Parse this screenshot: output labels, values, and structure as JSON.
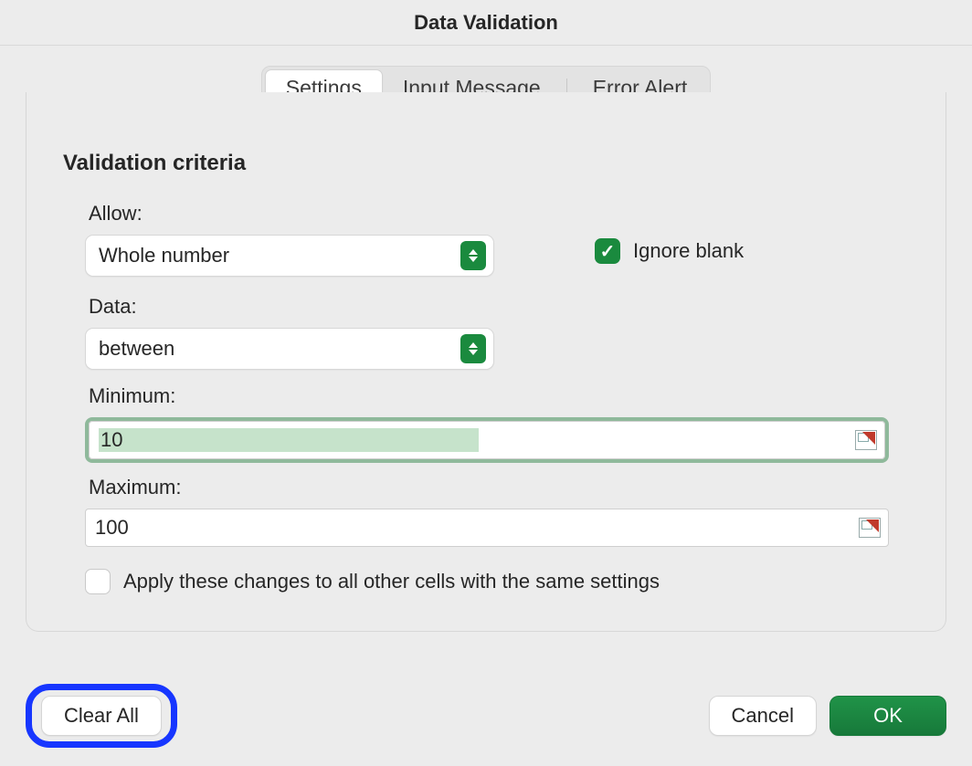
{
  "title": "Data Validation",
  "tabs": {
    "settings": "Settings",
    "input_message": "Input Message",
    "error_alert": "Error Alert"
  },
  "section_title": "Validation criteria",
  "labels": {
    "allow": "Allow:",
    "data": "Data:",
    "minimum": "Minimum:",
    "maximum": "Maximum:",
    "ignore_blank": "Ignore blank",
    "apply_all": "Apply these changes to all other cells with the same settings"
  },
  "values": {
    "allow": "Whole number",
    "data": "between",
    "minimum": "10",
    "maximum": "100",
    "ignore_blank_checked": true,
    "apply_all_checked": false
  },
  "buttons": {
    "clear_all": "Clear All",
    "cancel": "Cancel",
    "ok": "OK"
  }
}
